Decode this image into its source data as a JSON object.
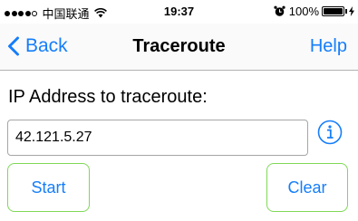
{
  "status_bar": {
    "carrier": "中国联通",
    "time": "19:37",
    "battery_percent": "100%",
    "signal_bars_filled": 4,
    "signal_bars_total": 5
  },
  "nav": {
    "back_label": "Back",
    "title": "Traceroute",
    "help_label": "Help"
  },
  "form": {
    "label": "IP Address to traceroute:",
    "ip_value": "42.121.5.27"
  },
  "buttons": {
    "start_label": "Start",
    "clear_label": "Clear"
  },
  "colors": {
    "accent": "#157efb",
    "button_border": "#7ed957"
  },
  "icons": {
    "back": "chevron-left-icon",
    "info": "info-circle-icon",
    "wifi": "wifi-icon",
    "alarm": "alarm-clock-icon",
    "battery": "battery-icon",
    "charging": "charging-bolt-icon"
  }
}
